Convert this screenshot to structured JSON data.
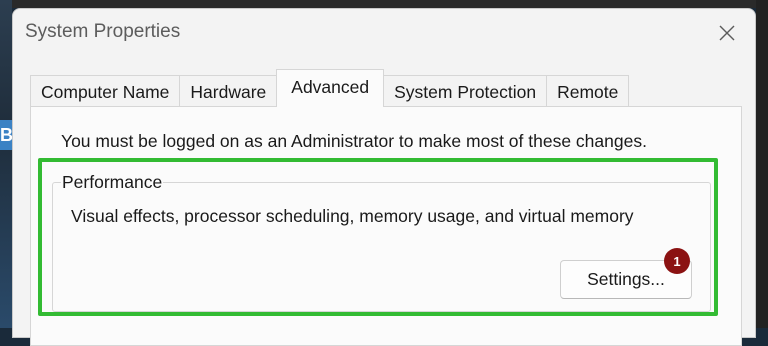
{
  "window": {
    "title": "System Properties"
  },
  "tabs": [
    {
      "label": "Computer Name"
    },
    {
      "label": "Hardware"
    },
    {
      "label": "Advanced",
      "active": true
    },
    {
      "label": "System Protection"
    },
    {
      "label": "Remote"
    }
  ],
  "advanced": {
    "admin_note": "You must be logged on as an Administrator to make most of these changes.",
    "performance": {
      "label": "Performance",
      "description": "Visual effects, processor scheduling, memory usage, and virtual memory",
      "settings_button": "Settings..."
    }
  },
  "annotation": {
    "badge_number": "1",
    "badge_color": "#8b1212",
    "highlight_color": "#33bb33"
  },
  "desktop": {
    "partial_letter": "B"
  },
  "icons": {
    "close": "close-icon"
  }
}
